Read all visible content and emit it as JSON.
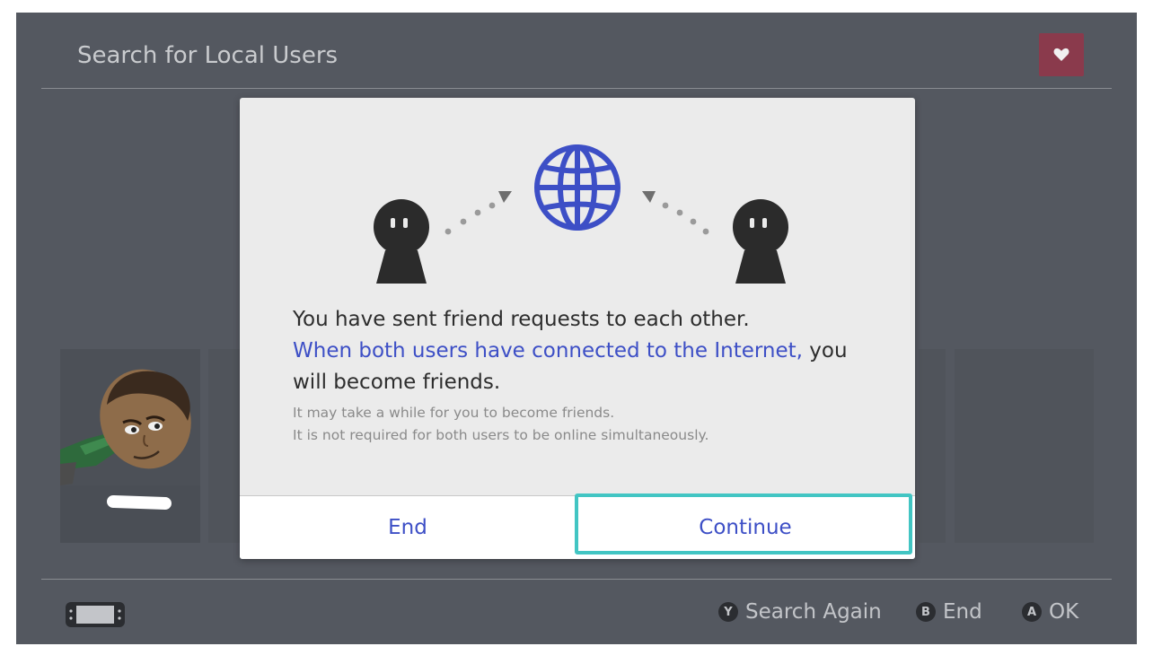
{
  "screen": {
    "title": "Search for Local Users"
  },
  "dialog": {
    "line1": "You have sent friend requests to each other.",
    "link_text": "When both users have connected to the Internet,",
    "line2_rest": " you",
    "line3": "will become friends.",
    "note1": "It may take a while for you to become friends.",
    "note2": "It is not required for both users to be online simultaneously.",
    "buttons": {
      "end": "End",
      "continue": "Continue"
    }
  },
  "footer": {
    "hints": [
      {
        "button": "Y",
        "label": "Search Again"
      },
      {
        "button": "B",
        "label": "End"
      },
      {
        "button": "A",
        "label": "OK"
      }
    ]
  },
  "colors": {
    "accent_blue": "#3d4fc6",
    "focus_cyan": "#42c5c3",
    "heart_button": "#8a3a4c"
  },
  "icons": [
    "heart-icon",
    "globe-icon",
    "user-silhouette-icon",
    "console-handheld-icon"
  ]
}
